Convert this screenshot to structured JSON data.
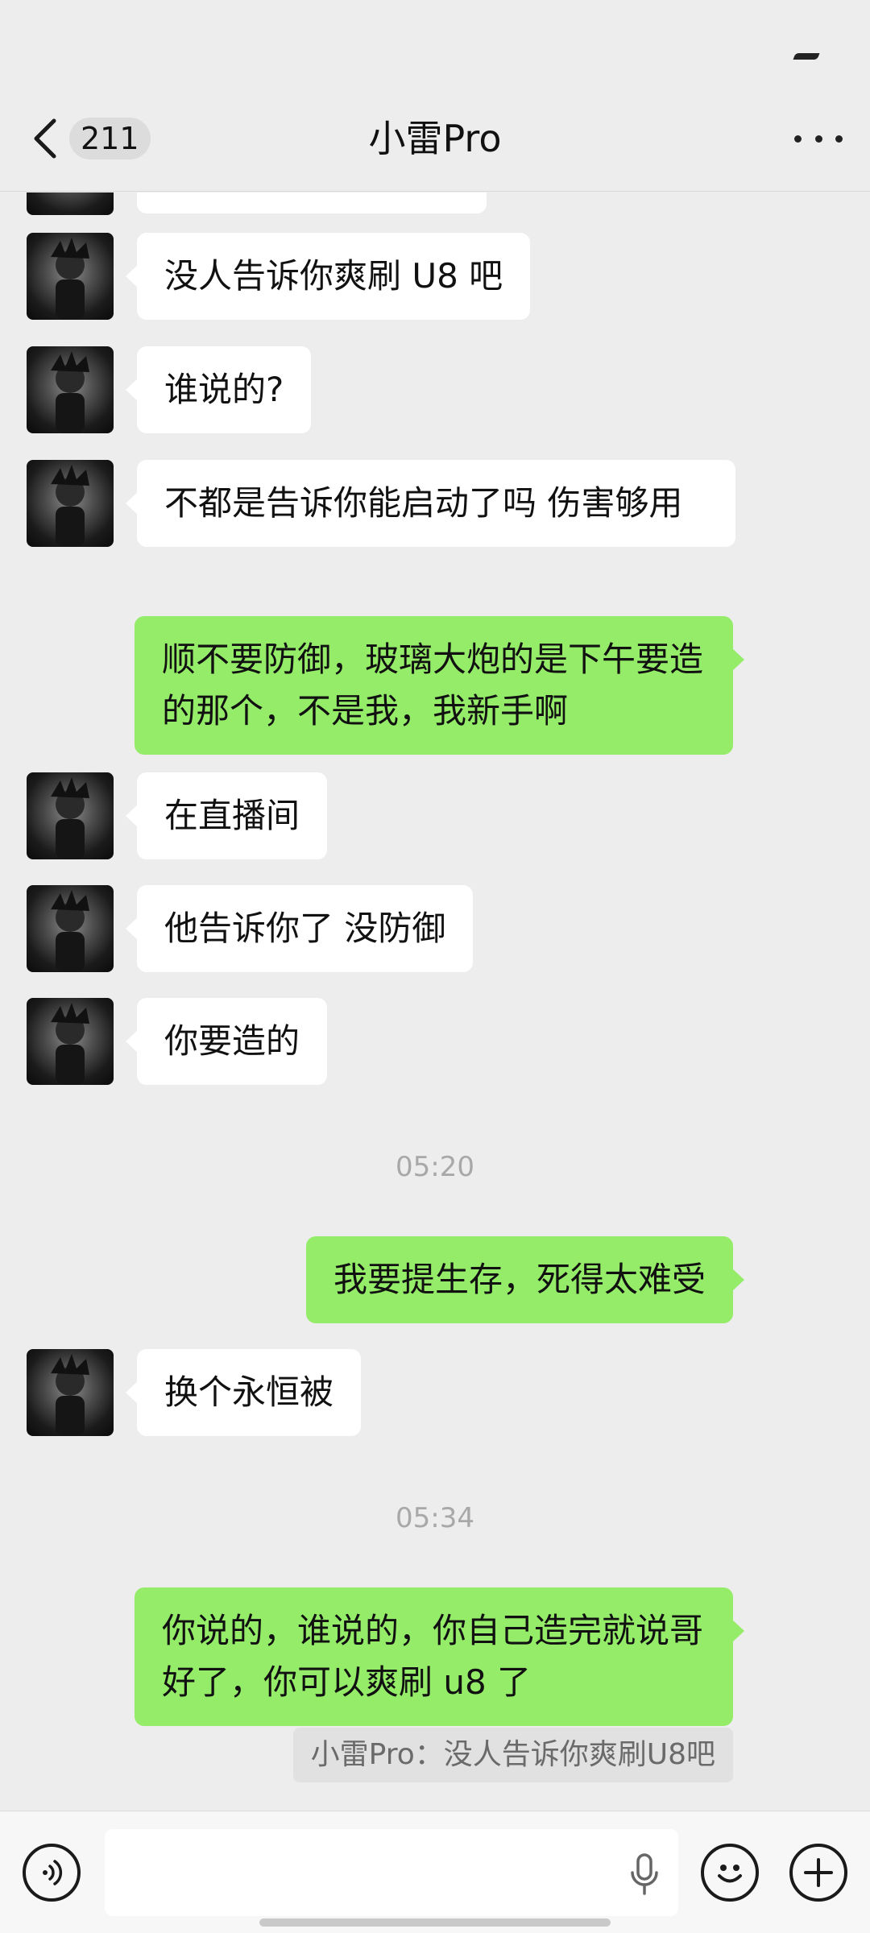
{
  "header": {
    "unread_count": "211",
    "title": "小雷Pro"
  },
  "messages": [
    {
      "side": "in",
      "text": "没人告诉你爽刷 U8 吧"
    },
    {
      "side": "in",
      "text": "谁说的?"
    },
    {
      "side": "in",
      "text": "不都是告诉你能启动了吗 伤害够用"
    },
    {
      "side": "out",
      "text": "顺不要防御，玻璃大炮的是下午要造的那个，不是我，我新手啊"
    },
    {
      "side": "in",
      "text": "在直播间"
    },
    {
      "side": "in",
      "text": "他告诉你了 没防御"
    },
    {
      "side": "in",
      "text": "你要造的"
    },
    {
      "side": "time",
      "text": "05:20"
    },
    {
      "side": "out",
      "text": "我要提生存，死得太难受"
    },
    {
      "side": "in",
      "text": "换个永恒被"
    },
    {
      "side": "time",
      "text": "05:34"
    },
    {
      "side": "out",
      "text": "你说的，谁说的，你自己造完就说哥好了，你可以爽刷 u8 了"
    },
    {
      "side": "quote",
      "text": "小雷Pro：没人告诉你爽刷U8吧"
    }
  ],
  "input": {
    "icons": [
      "voice-icon",
      "microphone-icon",
      "emoji-icon",
      "plus-icon"
    ]
  },
  "colors": {
    "background": "#ededed",
    "incoming_bubble": "#ffffff",
    "outgoing_bubble": "#95ec69"
  }
}
